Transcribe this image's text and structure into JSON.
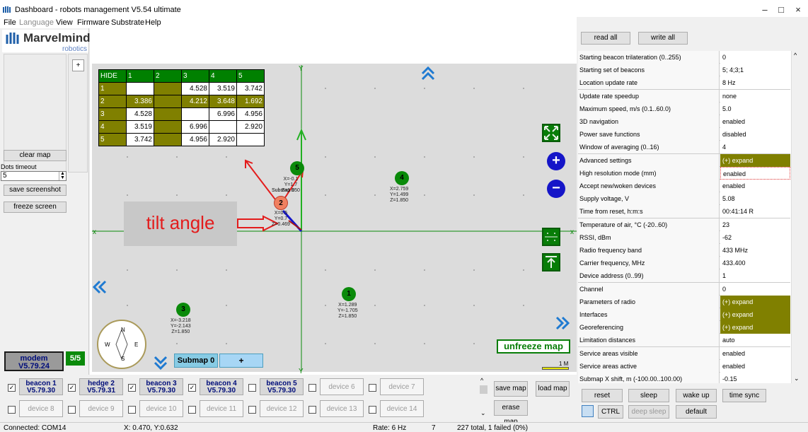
{
  "window": {
    "title": "Dashboard - robots management  V5.54  ultimate",
    "min": "–",
    "max": "□",
    "close": "×"
  },
  "menu": [
    {
      "label": "File",
      "enabled": true
    },
    {
      "label": "Language",
      "enabled": false
    },
    {
      "label": "View",
      "enabled": true
    },
    {
      "label": "Firmware",
      "enabled": true
    },
    {
      "label": "Substrate",
      "enabled": true
    },
    {
      "label": "Help",
      "enabled": true
    }
  ],
  "logo": {
    "name": "Marvelmind",
    "sub": "robotics"
  },
  "left": {
    "clear_map": "clear map",
    "dots_timeout_label": "Dots timeout",
    "dots_timeout_value": "5",
    "save_screenshot": "save screenshot",
    "freeze_screen": "freeze screen",
    "crosshair": "+"
  },
  "distance_table": {
    "header": [
      "HIDE",
      "1",
      "2",
      "3",
      "4",
      "5"
    ],
    "rows": [
      [
        "1",
        "",
        "",
        "4.528",
        "3.519",
        "3.742"
      ],
      [
        "2",
        "3.386",
        "",
        "4.212",
        "3.648",
        "1.692"
      ],
      [
        "3",
        "4.528",
        "",
        "",
        "6.996",
        "4.956"
      ],
      [
        "4",
        "3.519",
        "",
        "6.996",
        "",
        "2.920"
      ],
      [
        "5",
        "3.742",
        "",
        "4.956",
        "2.920",
        ""
      ]
    ]
  },
  "annotation": "tilt angle",
  "beacons": [
    {
      "id": "1",
      "coords": "X=1.289\nY=-1.705\nZ=1.850"
    },
    {
      "id": "2",
      "coords": "X=0.5\nY=0.7\nZ=0.469"
    },
    {
      "id": "3",
      "coords": "X=-3.218\nY=-2.143\nZ=1.850"
    },
    {
      "id": "4",
      "coords": "X=2.759\nY=1.499\nZ=1.850"
    },
    {
      "id": "5",
      "coords": "X=-0.1\nY=1.7\nZ=1.850"
    }
  ],
  "submap_text": "Submap 0",
  "submap": {
    "label": "Submap 0",
    "add": "+"
  },
  "compass": {
    "n": "N",
    "s": "S",
    "e": "E",
    "w": "W"
  },
  "modem": {
    "line1": "modem",
    "line2": "V5.79.24",
    "count": "5/5"
  },
  "map_controls": {
    "unfreeze": "unfreeze map",
    "scale": "1 M",
    "plus": "+",
    "minus": "−"
  },
  "devices_row1": [
    {
      "name": "beacon 1",
      "ver": "V5.79.30",
      "checked": true,
      "active": true
    },
    {
      "name": "hedge 2",
      "ver": "V5.79.31",
      "checked": true,
      "active": true
    },
    {
      "name": "beacon 3",
      "ver": "V5.79.30",
      "checked": true,
      "active": true
    },
    {
      "name": "beacon 4",
      "ver": "V5.79.30",
      "checked": true,
      "active": true
    },
    {
      "name": "beacon 5",
      "ver": "V5.79.30",
      "checked": false,
      "active": true
    },
    {
      "name": "device 6",
      "ver": "",
      "checked": false,
      "active": false
    },
    {
      "name": "device 7",
      "ver": "",
      "checked": false,
      "active": false
    }
  ],
  "devices_row2": [
    {
      "name": "device 8"
    },
    {
      "name": "device 9"
    },
    {
      "name": "device 10"
    },
    {
      "name": "device 11"
    },
    {
      "name": "device 12"
    },
    {
      "name": "device 13"
    },
    {
      "name": "device 14"
    }
  ],
  "map_buttons": {
    "save": "save map",
    "load": "load map",
    "erase": "erase map"
  },
  "right": {
    "read_all": "read all",
    "write_all": "write all",
    "rows": [
      {
        "k": "Starting beacon trilateration (0..255)",
        "v": "0"
      },
      {
        "k": "Starting set of beacons",
        "v": "5;  4;3;1"
      },
      {
        "k": "Location update rate",
        "v": "8 Hz"
      },
      {
        "k": "Update rate speedup",
        "v": "none"
      },
      {
        "k": "Maximum speed, m/s (0.1..60.0)",
        "v": "5.0"
      },
      {
        "k": "3D navigation",
        "v": "enabled"
      },
      {
        "k": "Power save functions",
        "v": "disabled"
      },
      {
        "k": "Window of averaging (0..16)",
        "v": "4"
      },
      {
        "k": "Advanced settings",
        "v": "(+) expand",
        "exp": true
      },
      {
        "k": "High resolution mode (mm)",
        "v": "enabled",
        "sel": true
      },
      {
        "k": "Accept new/woken devices",
        "v": "enabled"
      },
      {
        "k": "Supply voltage, V",
        "v": "5.08"
      },
      {
        "k": "Time from reset, h:m:s",
        "v": "00:41:14   R"
      },
      {
        "k": "Temperature of air, °C (-20..60)",
        "v": "23"
      },
      {
        "k": "RSSI, dBm",
        "v": "-62"
      },
      {
        "k": "Radio frequency band",
        "v": "433 MHz"
      },
      {
        "k": "Carrier frequency, MHz",
        "v": "433.400"
      },
      {
        "k": "Device address (0..99)",
        "v": "1"
      },
      {
        "k": "Channel",
        "v": "0"
      },
      {
        "k": "Parameters of radio",
        "v": "(+) expand",
        "exp": true
      },
      {
        "k": "Interfaces",
        "v": "(+) expand",
        "exp": true
      },
      {
        "k": "Georeferencing",
        "v": "(+) expand",
        "exp": true
      },
      {
        "k": "Limitation distances",
        "v": "auto"
      },
      {
        "k": "Service areas visible",
        "v": "enabled"
      },
      {
        "k": "Service areas active",
        "v": "enabled"
      },
      {
        "k": "Submap X shift, m (-100.00..100.00)",
        "v": "-0.15"
      }
    ],
    "reset": "reset",
    "sleep": "sleep",
    "wake_up": "wake up",
    "time_sync": "time sync",
    "ctrl": "CTRL",
    "deep_sleep": "deep sleep",
    "default": "default"
  },
  "status": {
    "conn": "Connected: COM14",
    "coords": "X: 0.470, Y:0.632",
    "rate": "Rate: 6 Hz",
    "n": "7",
    "total": "227 total, 1 failed (0%)"
  }
}
